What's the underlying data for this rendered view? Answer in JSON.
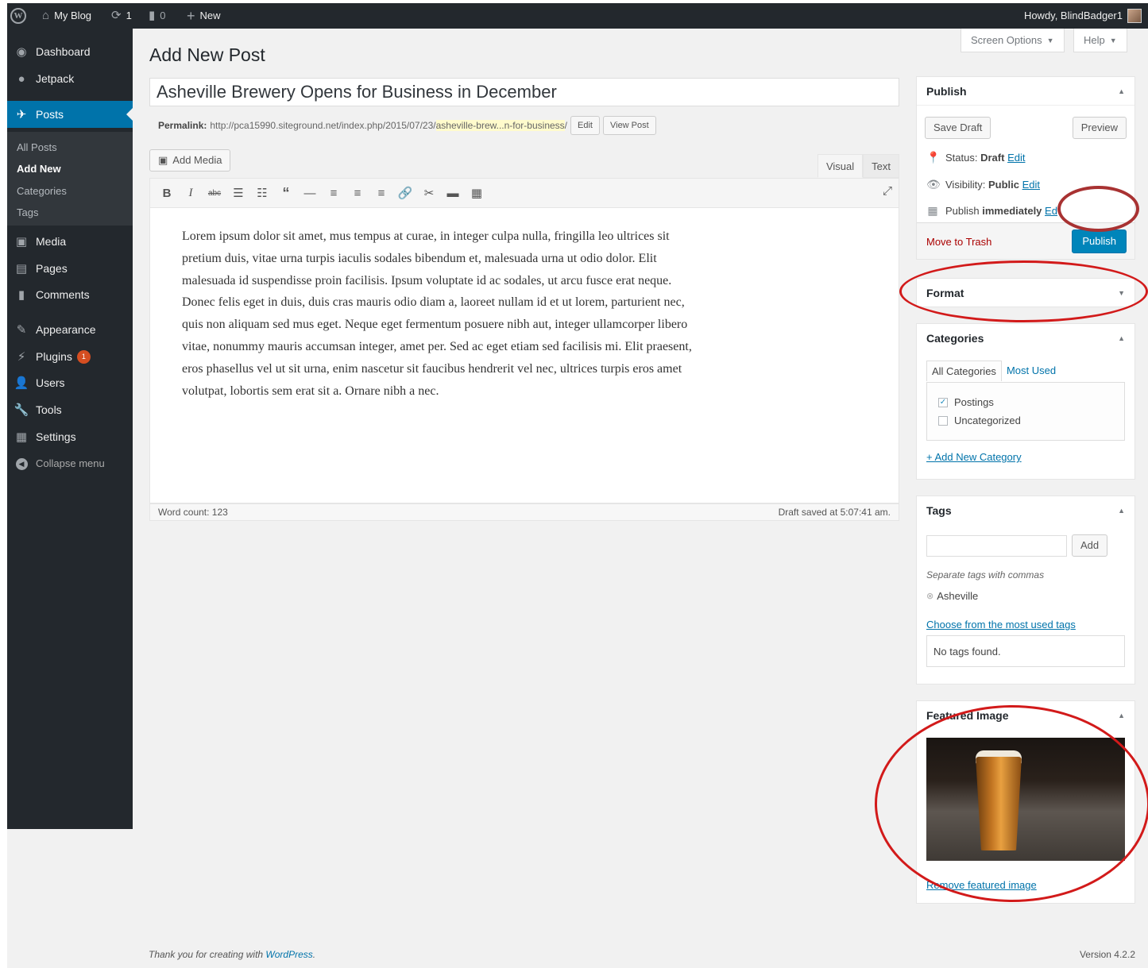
{
  "adminbar": {
    "site_name": "My Blog",
    "updates_count": "1",
    "comments_count": "0",
    "new_label": "New",
    "howdy": "Howdy, BlindBadger1"
  },
  "sidebar": {
    "items": [
      {
        "label": "Dashboard",
        "icon": "dashboard-icon"
      },
      {
        "label": "Jetpack",
        "icon": "jetpack-icon"
      },
      {
        "label": "Posts",
        "icon": "pushpin-icon"
      },
      {
        "label": "Media",
        "icon": "media-icon"
      },
      {
        "label": "Pages",
        "icon": "pages-icon"
      },
      {
        "label": "Comments",
        "icon": "comment-icon"
      },
      {
        "label": "Appearance",
        "icon": "paintbrush-icon"
      },
      {
        "label": "Plugins",
        "icon": "plugin-icon",
        "badge": "1"
      },
      {
        "label": "Users",
        "icon": "user-icon"
      },
      {
        "label": "Tools",
        "icon": "wrench-icon"
      },
      {
        "label": "Settings",
        "icon": "settings-icon"
      }
    ],
    "submenu": [
      "All Posts",
      "Add New",
      "Categories",
      "Tags"
    ],
    "collapse": "Collapse menu"
  },
  "screen_options": "Screen Options",
  "help": "Help",
  "page_title": "Add New Post",
  "post": {
    "title": "Asheville Brewery Opens for Business in December",
    "permalink_label": "Permalink:",
    "permalink_base": "http://pca15990.siteground.net/index.php/2015/07/23/",
    "permalink_slug": "asheville-brew...n-for-business",
    "permalink_end": "/",
    "edit_btn": "Edit",
    "view_btn": "View Post",
    "body": "Lorem ipsum dolor sit amet, mus tempus at curae, in integer culpa nulla, fringilla leo ultrices sit pretium duis, vitae urna turpis iaculis sodales bibendum et, malesuada urna ut odio dolor. Elit malesuada id suspendisse proin facilisis. Ipsum voluptate id ac sodales, ut arcu fusce erat neque. Donec felis eget in duis, duis cras mauris odio diam a, laoreet nullam id et ut lorem, parturient nec, quis non aliquam sed mus eget. Neque eget fermentum posuere nibh aut, integer ullamcorper libero vitae, nonummy mauris accumsan integer, amet per. Sed ac eget etiam sed facilisis mi. Elit praesent, eros phasellus vel ut sit urna, enim nascetur sit faucibus hendrerit vel nec, ultrices turpis eros amet volutpat, lobortis sem erat sit a. Ornare nibh a nec.",
    "word_count": "Word count: 123",
    "draft_saved": "Draft saved at 5:07:41 am."
  },
  "editor": {
    "add_media": "Add Media",
    "tab_visual": "Visual",
    "tab_text": "Text"
  },
  "publish": {
    "title": "Publish",
    "save_draft": "Save Draft",
    "preview": "Preview",
    "status_label": "Status:",
    "status_value": "Draft",
    "visibility_label": "Visibility:",
    "visibility_value": "Public",
    "publish_label": "Publish",
    "publish_value": "immediately",
    "edit_link": "Edit",
    "edit_link_clipped": "Ed",
    "trash": "Move to Trash",
    "publish_btn": "Publish"
  },
  "format": {
    "title": "Format"
  },
  "categories": {
    "title": "Categories",
    "tab_all": "All Categories",
    "tab_used": "Most Used",
    "items": [
      {
        "label": "Postings",
        "checked": true
      },
      {
        "label": "Uncategorized",
        "checked": false
      }
    ],
    "add_new": "+ Add New Category"
  },
  "tags": {
    "title": "Tags",
    "input_value": "",
    "add_btn": "Add",
    "hint": "Separate tags with commas",
    "tag": "Asheville",
    "choose": "Choose from the most used tags",
    "none": "No tags found."
  },
  "featured": {
    "title": "Featured Image",
    "remove": "Remove featured image"
  },
  "footer": {
    "thanks": "Thank you for creating with ",
    "wp": "WordPress",
    "period": ".",
    "version": "Version 4.2.2"
  },
  "colors": {
    "admin_bar": "#23282d",
    "accent": "#0073aa",
    "annotation_red": "#d21a1a"
  }
}
